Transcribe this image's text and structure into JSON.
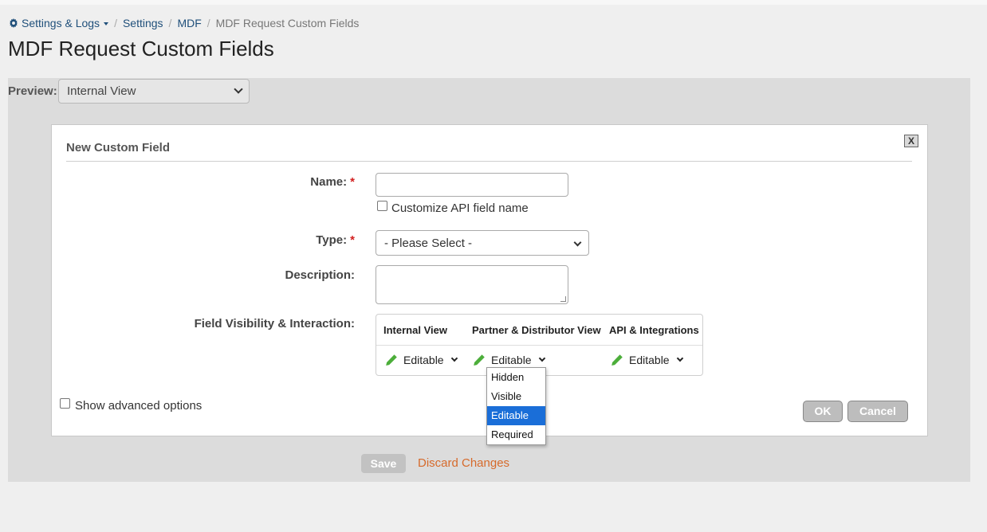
{
  "breadcrumb": {
    "items": [
      "Settings & Logs",
      "Settings",
      "MDF"
    ],
    "current": "MDF Request Custom Fields"
  },
  "page": {
    "title": "MDF Request Custom Fields"
  },
  "preview": {
    "label": "Preview:",
    "value": "Internal View"
  },
  "modal": {
    "title": "New Custom Field",
    "close_label": "X",
    "name_label": "Name:",
    "required_mark": "*",
    "customize_api_label": "Customize API field name",
    "type_label": "Type:",
    "type_value": "- Please Select -",
    "description_label": "Description:",
    "visibility_label": "Field Visibility & Interaction:",
    "visibility": {
      "columns": [
        "Internal View",
        "Partner & Distributor View",
        "API & Integrations"
      ],
      "values": [
        "Editable",
        "Editable",
        "Editable"
      ]
    },
    "dropdown_options": [
      "Hidden",
      "Visible",
      "Editable",
      "Required"
    ],
    "dropdown_selected": "Editable",
    "advanced_label": "Show advanced options",
    "ok_label": "OK",
    "cancel_label": "Cancel"
  },
  "footer": {
    "save_label": "Save",
    "discard_label": "Discard Changes"
  },
  "colors": {
    "accent_link": "#1f4f7a",
    "discard": "#d66a2b",
    "pencil": "#4cae3a",
    "selected": "#1a6ed8",
    "required": "#d21f1f"
  },
  "icons": {
    "gear": "gear-icon",
    "pencil": "pencil-icon"
  }
}
